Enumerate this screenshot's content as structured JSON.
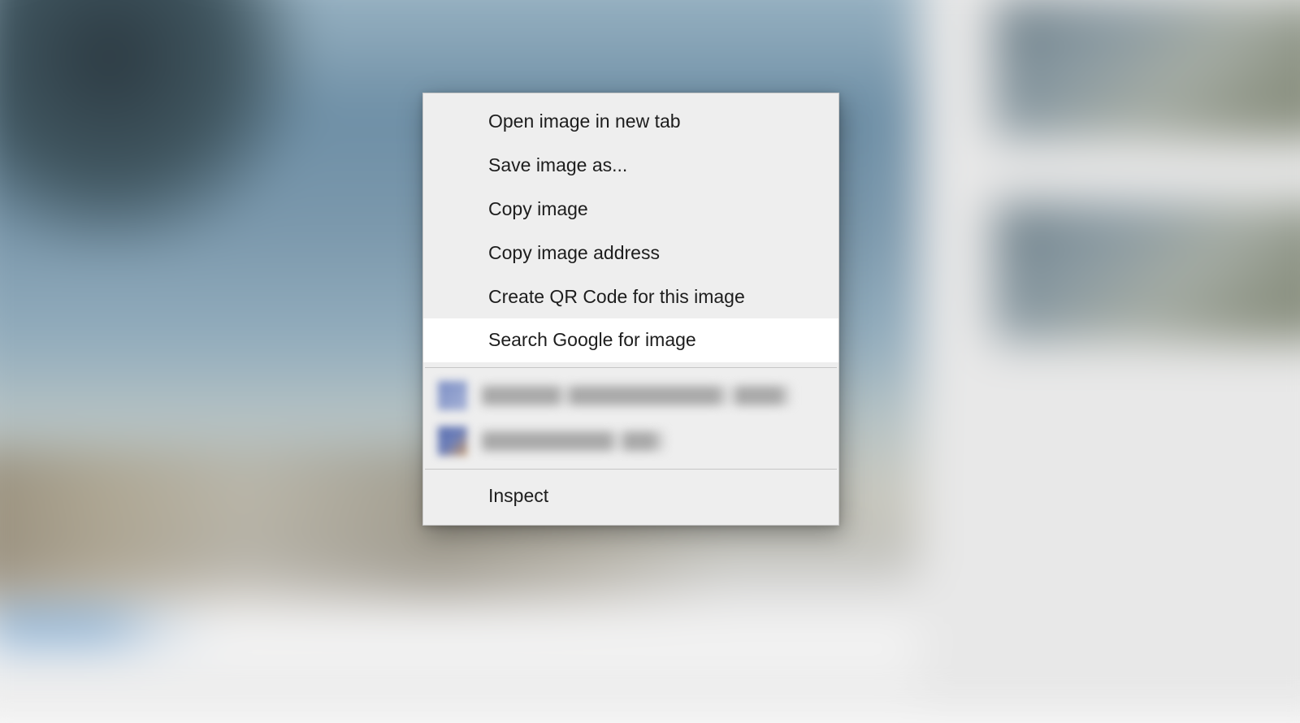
{
  "context_menu": {
    "items": [
      {
        "label": "Open image in new tab"
      },
      {
        "label": "Save image as..."
      },
      {
        "label": "Copy image"
      },
      {
        "label": "Copy image address"
      },
      {
        "label": "Create QR Code for this image"
      },
      {
        "label": "Search Google for image",
        "highlighted": true
      }
    ],
    "inspect_label": "Inspect"
  }
}
